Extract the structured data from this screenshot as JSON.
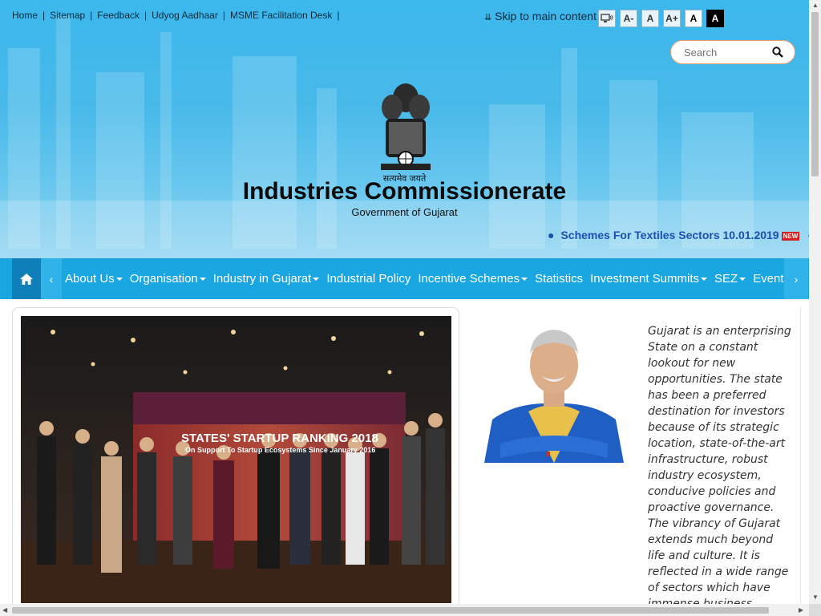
{
  "topnav": {
    "links": [
      "Home",
      "Sitemap",
      "Feedback",
      "Udyog Aadhaar",
      "MSME Facilitation Desk"
    ],
    "skip_label": "Skip to main content"
  },
  "font_controls": {
    "decrease": "A-",
    "normal": "A",
    "increase": "A+",
    "theme_light": "A",
    "theme_dark": "A"
  },
  "search": {
    "placeholder": "Search"
  },
  "branding": {
    "motto": "सत्यमेव जयते",
    "title": "Industries Commissionerate",
    "subtitle": "Government of Gujarat"
  },
  "ticker": {
    "item": "Schemes For Textiles Sectors 10.01.2019",
    "badge": "NEW"
  },
  "menu": {
    "items": [
      {
        "label": "About Us",
        "dropdown": true
      },
      {
        "label": "Organisation",
        "dropdown": true
      },
      {
        "label": "Industry in Gujarat",
        "dropdown": true
      },
      {
        "label": "Industrial Policy",
        "dropdown": false
      },
      {
        "label": "Incentive Schemes",
        "dropdown": true
      },
      {
        "label": "Statistics",
        "dropdown": false
      },
      {
        "label": "Investment Summits",
        "dropdown": true
      },
      {
        "label": "SEZ",
        "dropdown": true
      },
      {
        "label": "Event",
        "dropdown": false
      }
    ]
  },
  "slider": {
    "banner_title": "STATES' STARTUP RANKING 2018",
    "banner_sub": "On Support To Startup Ecosystems Since January 2016"
  },
  "about": {
    "text": "Gujarat is an enterprising State on a constant lookout for new opportunities. The state has been a preferred destination for investors because of its strategic location, state-of-the-art infrastructure, robust industry ecosystem, conducive policies and proactive governance. The vibrancy of Gujarat extends much beyond life and culture. It is reflected in a wide range of sectors which have immense business potential."
  },
  "colors": {
    "header_blue": "#3cb8ec",
    "menu_blue": "#1aa7e1",
    "home_blue": "#0e7fb8",
    "ticker_blue": "#1c4fb0",
    "new_red": "#d32020"
  }
}
